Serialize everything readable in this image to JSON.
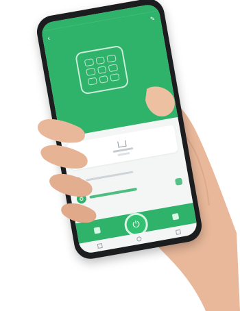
{
  "colors": {
    "accent": "#2fb36b",
    "phone_body": "#1b1d1f",
    "skin": "#e8b99a"
  },
  "icons": {
    "back": "back-arrow-icon",
    "edit": "edit-icon",
    "home": "home-icon",
    "main_action": "power-icon"
  }
}
